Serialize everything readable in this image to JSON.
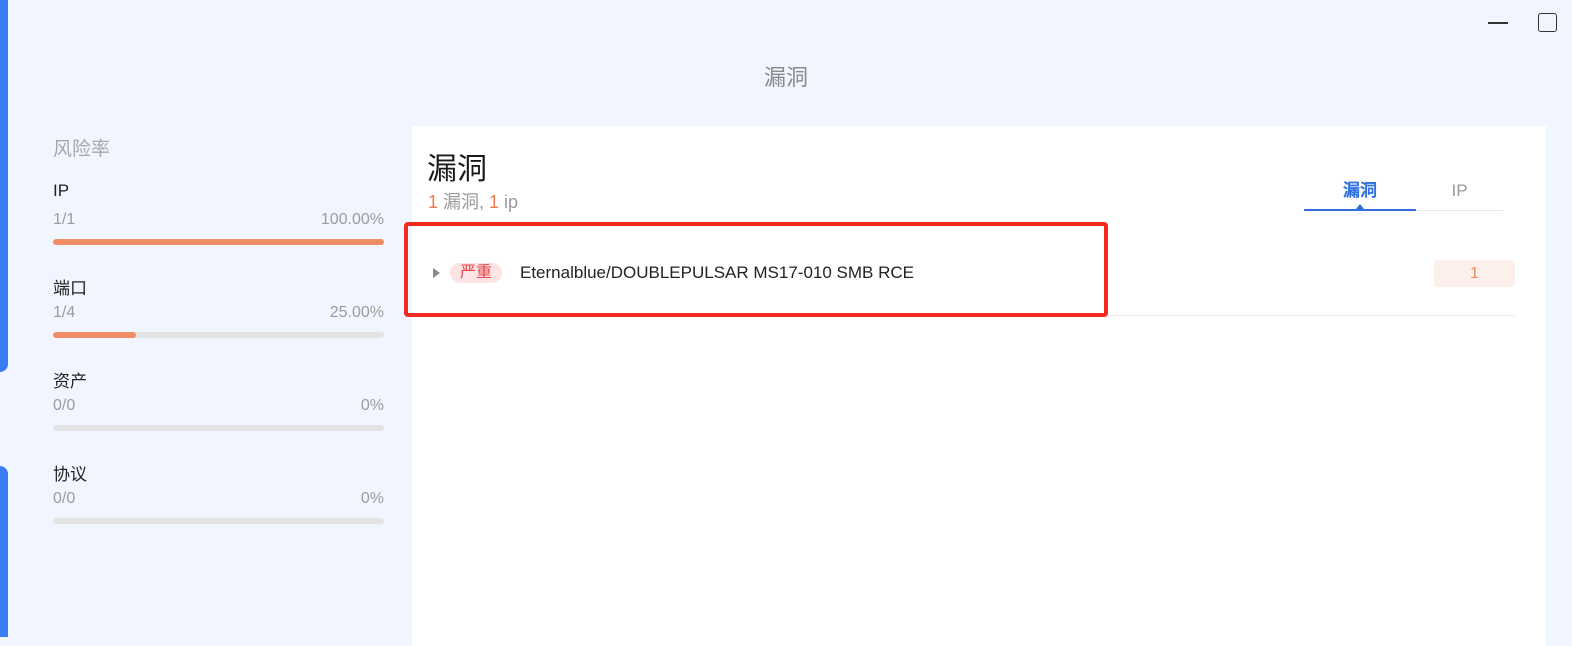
{
  "window": {
    "minimize_label": "",
    "maximize_label": ""
  },
  "page": {
    "title": "漏洞"
  },
  "risk": {
    "title": "风险率",
    "metrics": [
      {
        "label": "IP",
        "ratio": "1/1",
        "percent": "100.00%",
        "fill": 1.0
      },
      {
        "label": "端口",
        "ratio": "1/4",
        "percent": "25.00%",
        "fill": 0.25
      },
      {
        "label": "资产",
        "ratio": "0/0",
        "percent": "0%",
        "fill": 0
      },
      {
        "label": "协议",
        "ratio": "0/0",
        "percent": "0%",
        "fill": 0
      }
    ],
    "fill_color": "#f08c63"
  },
  "card": {
    "title": "漏洞",
    "subtitle": {
      "vuln_count": "1",
      "vuln_label": " 漏洞, ",
      "ip_count": "1",
      "ip_label": " ip"
    },
    "tabs": [
      {
        "label": "漏洞",
        "active": true
      },
      {
        "label": "IP",
        "active": false
      }
    ],
    "vulnerabilities": [
      {
        "severity": "严重",
        "name": "Eternalblue/DOUBLEPULSAR MS17-010 SMB RCE",
        "count": "1"
      }
    ]
  },
  "colors": {
    "accent": "#2f6fe0",
    "warning": "#ef7a4f",
    "critical": "#e4464a",
    "highlight": "#f42a1f"
  }
}
